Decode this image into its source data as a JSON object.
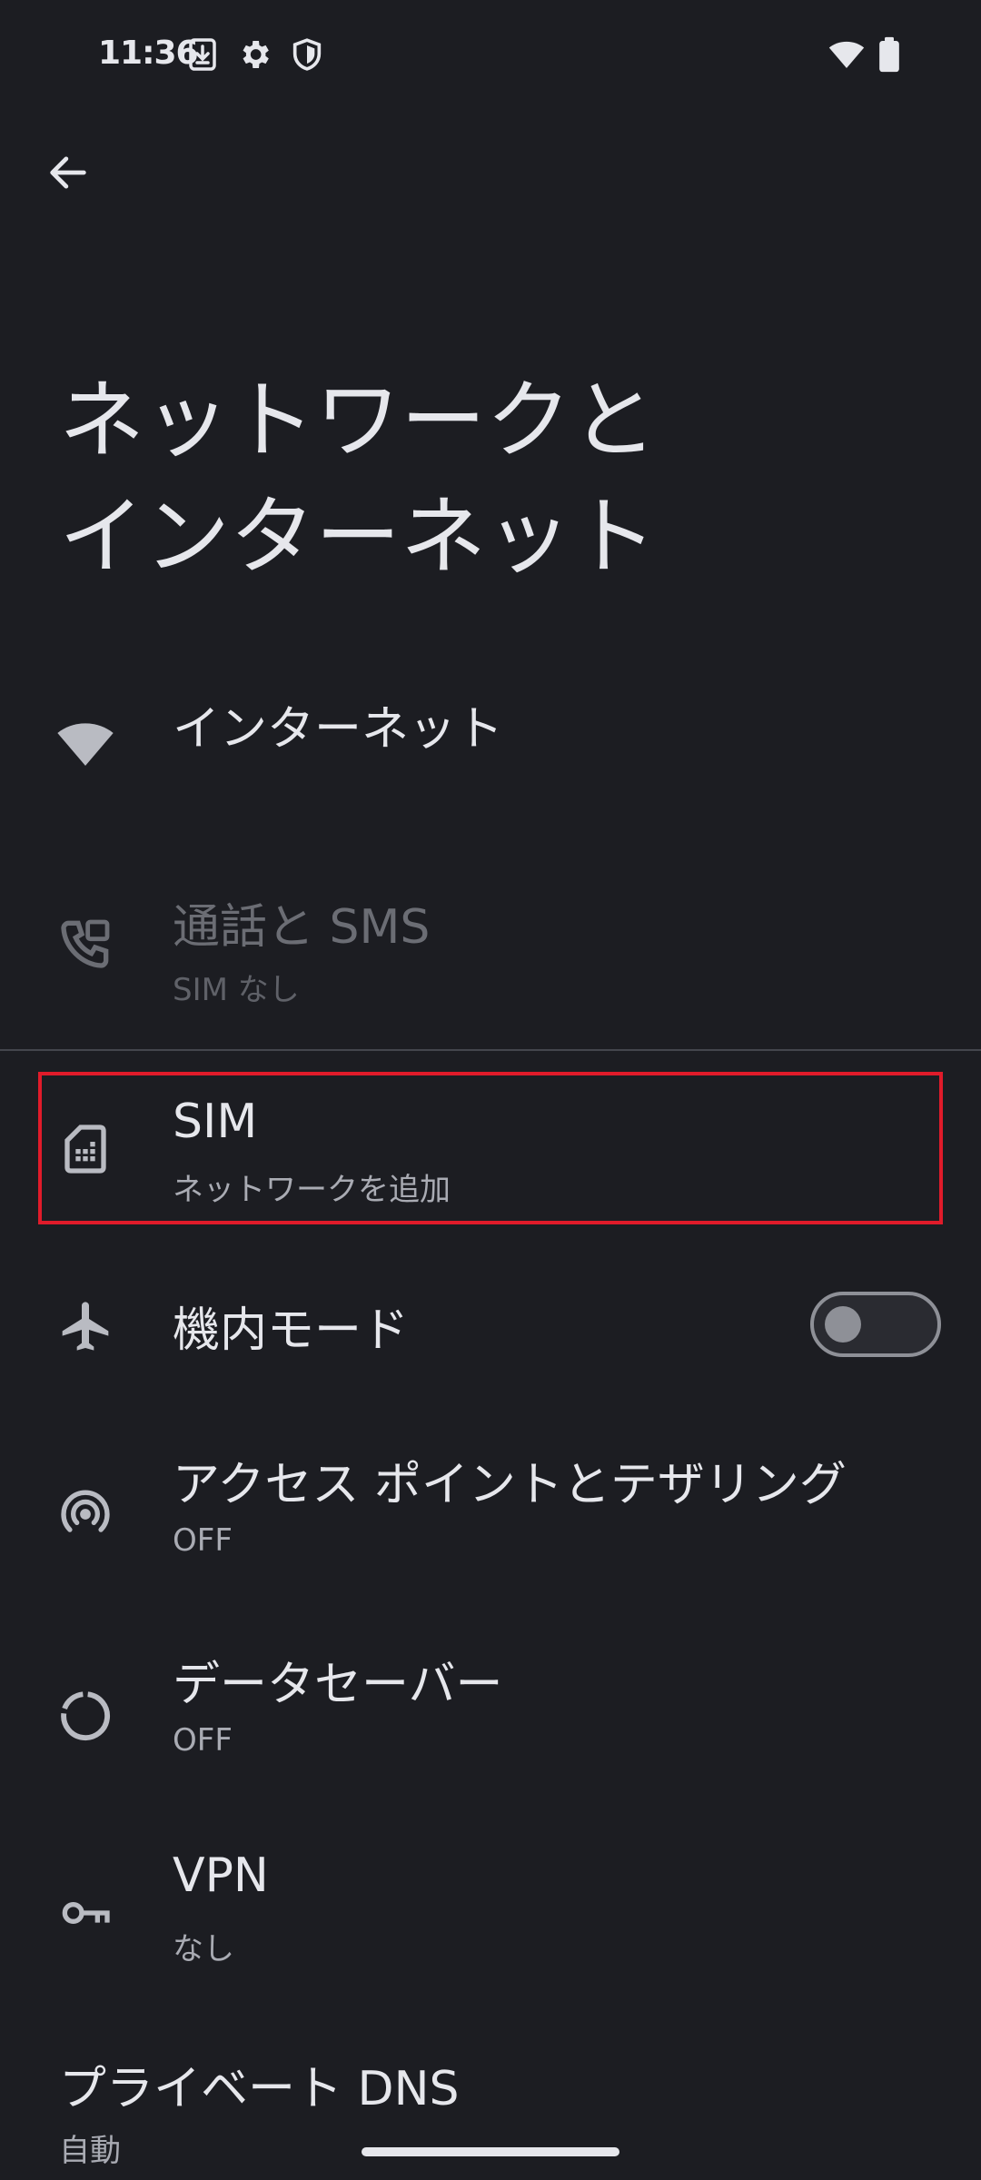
{
  "status_bar": {
    "time": "11:36",
    "icons": [
      "download-icon",
      "gear-icon",
      "shield-icon",
      "wifi-icon",
      "battery-icon"
    ]
  },
  "header": {
    "back_icon": "arrow-left-icon",
    "title_line1": "ネットワークと",
    "title_line2": "インターネット"
  },
  "items": [
    {
      "id": "internet",
      "icon": "wifi-icon",
      "title": "インターネット",
      "subtitle": ""
    },
    {
      "id": "calls-sms",
      "icon": "phone-forward-icon",
      "title": "通話と SMS",
      "subtitle": "SIM なし",
      "disabled": true
    },
    {
      "id": "sim",
      "icon": "sim-card-icon",
      "title": "SIM",
      "subtitle": "ネットワークを追加",
      "highlighted": true
    },
    {
      "id": "airplane",
      "icon": "airplane-icon",
      "title": "機内モード",
      "subtitle": "",
      "toggle": false
    },
    {
      "id": "hotspot",
      "icon": "hotspot-icon",
      "title": "アクセス ポイントとテザリング",
      "subtitle": "OFF"
    },
    {
      "id": "data-saver",
      "icon": "data-saver-icon",
      "title": "データセーバー",
      "subtitle": "OFF"
    },
    {
      "id": "vpn",
      "icon": "key-icon",
      "title": "VPN",
      "subtitle": "なし"
    },
    {
      "id": "private-dns",
      "icon": "",
      "title": "プライベート DNS",
      "subtitle": "自動"
    }
  ],
  "colors": {
    "background": "#1c1d22",
    "text_primary": "#e6e7ec",
    "text_secondary": "#a9abb3",
    "highlight": "#e01b2a"
  }
}
